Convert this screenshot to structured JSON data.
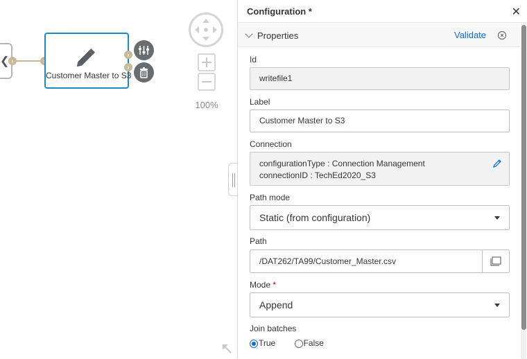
{
  "canvas": {
    "node_label": "Customer Master to S3",
    "zoom_level": "100%"
  },
  "panel": {
    "title": "Configuration *",
    "section_title": "Properties",
    "validate_label": "Validate",
    "fields": {
      "id_label": "Id",
      "id_value": "writefile1",
      "label_label": "Label",
      "label_value": "Customer Master to S3",
      "connection_label": "Connection",
      "connection_line1": "configurationType : Connection Management",
      "connection_line2": "connectionID : TechEd2020_S3",
      "path_mode_label": "Path mode",
      "path_mode_value": "Static (from configuration)",
      "path_label": "Path",
      "path_value": "/DAT262/TA99/Customer_Master.csv",
      "mode_label": "Mode",
      "mode_required": "*",
      "mode_value": "Append",
      "join_batches_label": "Join batches",
      "join_true": "True",
      "join_false": "False"
    }
  },
  "colors": {
    "accent": "#0a6ed1",
    "node_border": "#1a8ac6",
    "required": "#bb0000"
  }
}
